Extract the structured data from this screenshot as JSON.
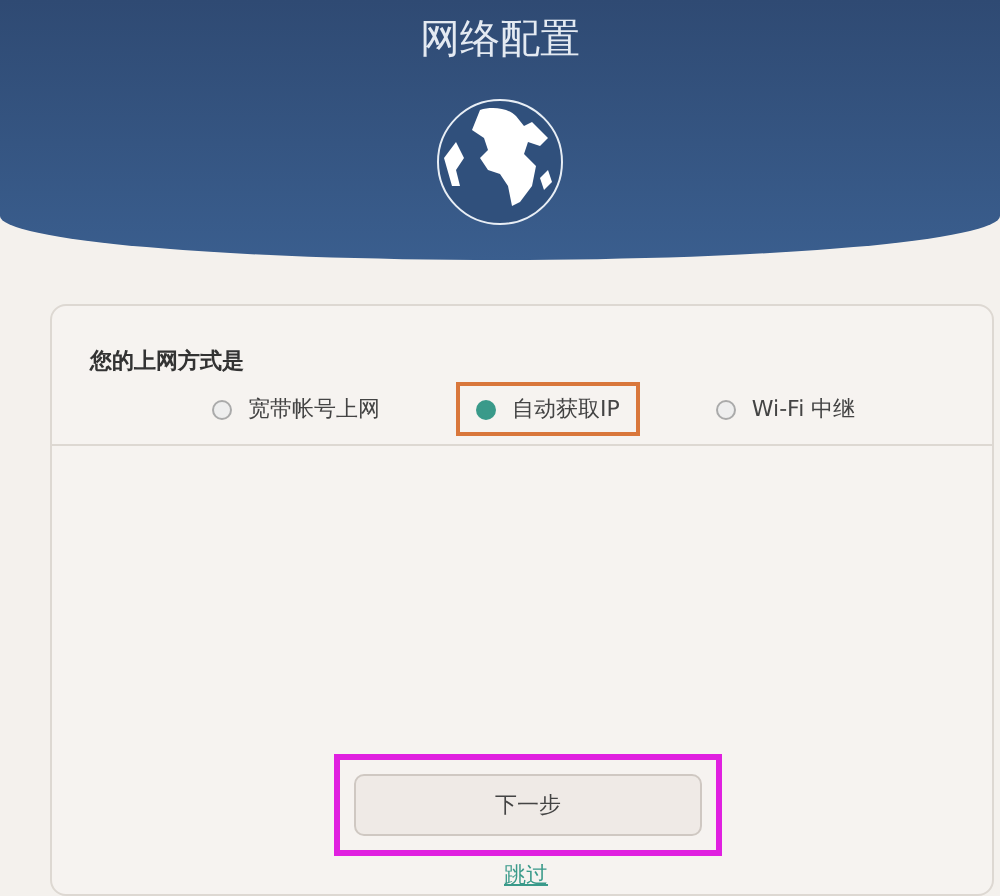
{
  "header": {
    "title": "网络配置"
  },
  "card": {
    "question": "您的上网方式是",
    "options": [
      {
        "label": "宽带帐号上网",
        "selected": false,
        "highlighted": false
      },
      {
        "label": "自动获取IP",
        "selected": true,
        "highlighted": true
      },
      {
        "label": "Wi-Fi 中继",
        "selected": false,
        "highlighted": false
      }
    ],
    "next_button": {
      "label": "下一步",
      "highlighted": true
    },
    "skip_link": "跳过"
  }
}
